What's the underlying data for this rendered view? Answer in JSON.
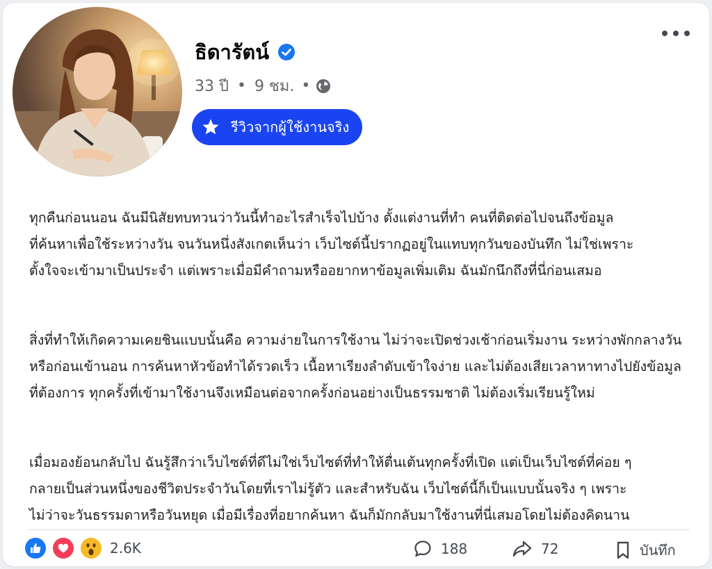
{
  "post": {
    "author_name": "ธิดารัตน์",
    "age": "33 ปี",
    "time_ago": "9 ชม.",
    "review_badge_label": "รีวิวจากผู้ใช้งานจริง",
    "paragraphs": [
      {
        "lines": [
          "ทุกคืนก่อนนอน ฉันมีนิสัยทบทวนว่าวันนี้ทำอะไรสำเร็จไปบ้าง ตั้งแต่งานที่ทำ คนที่ติดต่อไปจนถึงข้อมูล",
          "ที่ค้นหาเพื่อใช้ระหว่างวัน จนวันหนึ่งสังเกตเห็นว่า เว็บไซต์นี้ปรากฏอยู่ในแทบทุกวันของบันทึก ไม่ใช่เพราะ",
          "ตั้งใจจะเข้ามาเป็นประจำ แต่เพราะเมื่อมีคำถามหรืออยากหาข้อมูลเพิ่มเติม ฉันมักนึกถึงที่นี่ก่อนเสมอ"
        ]
      },
      {
        "lines": [
          "สิ่งที่ทำให้เกิดความเคยชินแบบนั้นคือ ความง่ายในการใช้งาน ไม่ว่าจะเปิดช่วงเช้าก่อนเริ่มงาน ระหว่างพักกลางวัน",
          "หรือก่อนเข้านอน การค้นหาหัวข้อทำได้รวดเร็ว เนื้อหาเรียงลำดับเข้าใจง่าย และไม่ต้องเสียเวลาหาทางไปยังข้อมูล",
          "ที่ต้องการ ทุกครั้งที่เข้ามาใช้งานจึงเหมือนต่อจากครั้งก่อนอย่างเป็นธรรมชาติ ไม่ต้องเริ่มเรียนรู้ใหม่"
        ]
      },
      {
        "lines": [
          "เมื่อมองย้อนกลับไป ฉันรู้สึกว่าเว็บไซต์ที่ดีไม่ใช่เว็บไซต์ที่ทำให้ตื่นเต้นทุกครั้งที่เปิด แต่เป็นเว็บไซต์ที่ค่อย ๆ",
          "กลายเป็นส่วนหนึ่งของชีวิตประจำวันโดยที่เราไม่รู้ตัว และสำหรับฉัน เว็บไซต์นี้ก็เป็นแบบนั้นจริง ๆ เพราะ",
          "ไม่ว่าจะวันธรรมดาหรือวันหยุด เมื่อมีเรื่องที่อยากค้นหา ฉันก็มักกลับมาใช้งานที่นี่เสมอโดยไม่ต้องคิดนาน"
        ]
      }
    ]
  },
  "stats": {
    "reaction_count": "2.6K",
    "comment_count": "188",
    "share_count": "72",
    "save_label": "บันทึก"
  },
  "icons": {
    "verified": "verified-badge-icon",
    "globe": "globe-icon",
    "star": "star-icon",
    "like": "like-icon",
    "love": "love-icon",
    "wow": "wow-icon",
    "comment": "comment-icon",
    "share": "share-icon",
    "bookmark": "bookmark-icon",
    "more": "more-options-icon"
  },
  "colors": {
    "badge_blue": "#1a44f2",
    "verified_blue": "#1877f2",
    "like_blue": "#1877f2",
    "love_red": "#f33e58",
    "wow_yellow": "#f7b928"
  }
}
